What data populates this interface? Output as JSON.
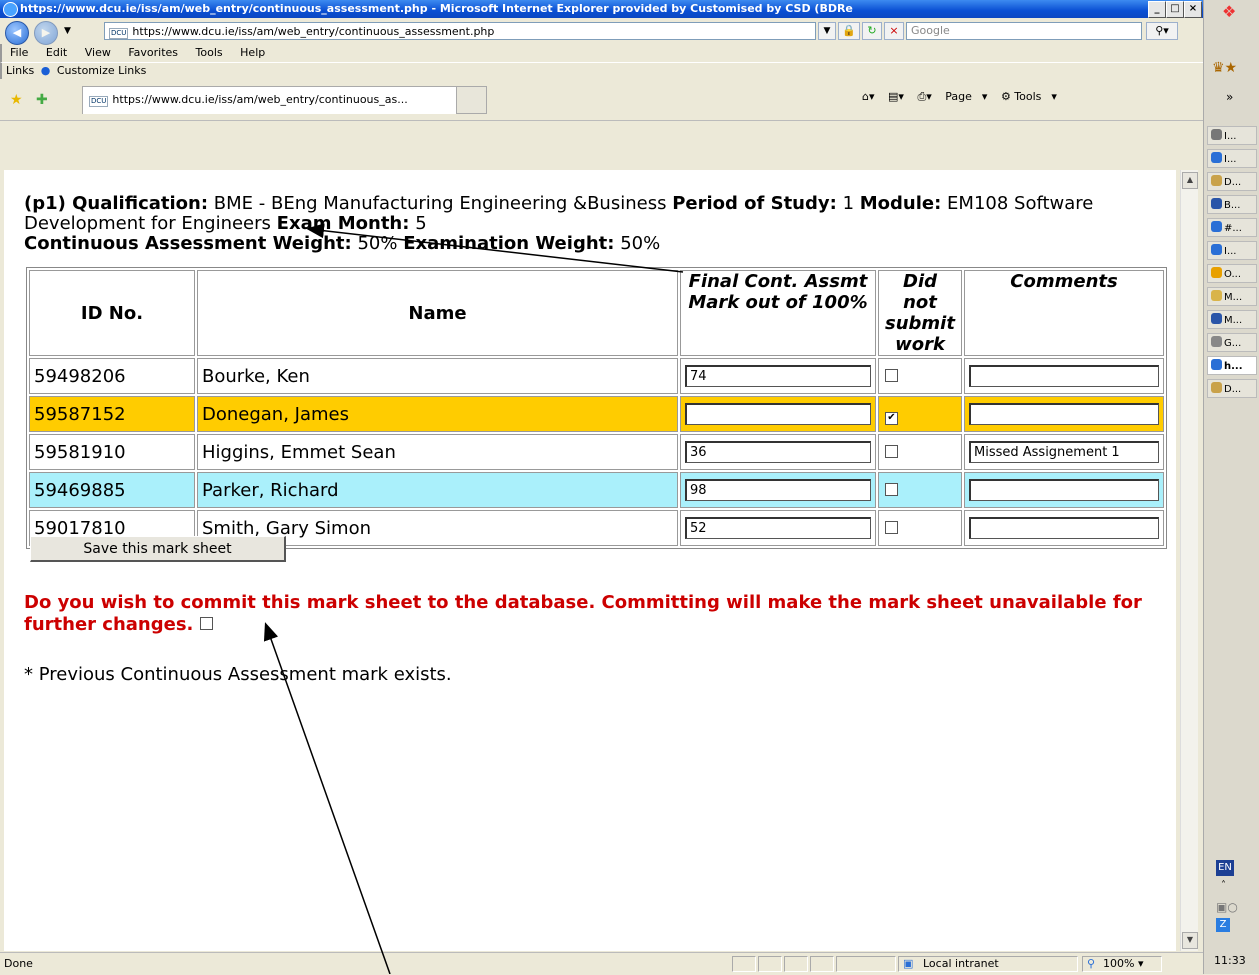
{
  "window": {
    "title": "https://www.dcu.ie/iss/am/web_entry/continuous_assessment.php - Microsoft Internet Explorer provided by Customised by CSD (BDRe"
  },
  "address": {
    "url": "https://www.dcu.ie/iss/am/web_entry/continuous_assessment.php",
    "search_placeholder": "Google",
    "favicon_text": "DCU"
  },
  "menu": [
    "File",
    "Edit",
    "View",
    "Favorites",
    "Tools",
    "Help"
  ],
  "links_bar": {
    "links_label": "Links",
    "customize": "Customize Links"
  },
  "tab": {
    "label": "https://www.dcu.ie/iss/am/web_entry/continuous_as..."
  },
  "command_bar": {
    "page": "Page",
    "tools": "Tools"
  },
  "header": {
    "prefix": "(p1) Qualification:",
    "qualification": "BME - BEng Manufacturing Engineering &Business",
    "period_label": "Period of Study:",
    "period": "1",
    "module_label": "Module:",
    "module": "EM108 Software Development for Engineers",
    "exam_month_label": "Exam Month:",
    "exam_month": "5",
    "ca_weight_label": "Continuous Assessment Weight:",
    "ca_weight": "50%",
    "exam_weight_label": "Examination Weight:",
    "exam_weight": "50%"
  },
  "table": {
    "columns": [
      "ID No.",
      "Name",
      "Final Cont. Assmt Mark out of 100%",
      "Did not submit work",
      "Comments"
    ],
    "rows": [
      {
        "id": "59498206",
        "name": "Bourke, Ken",
        "mark": "74",
        "did_not_submit": false,
        "comment": "",
        "highlight": "none"
      },
      {
        "id": "59587152",
        "name": "Donegan, James",
        "mark": "",
        "did_not_submit": true,
        "comment": "",
        "highlight": "yellow"
      },
      {
        "id": "59581910",
        "name": "Higgins, Emmet Sean",
        "mark": "36",
        "did_not_submit": false,
        "comment": "Missed Assignement 1",
        "highlight": "none"
      },
      {
        "id": "59469885",
        "name": "Parker, Richard",
        "mark": "98",
        "did_not_submit": false,
        "comment": "",
        "highlight": "cyan"
      },
      {
        "id": "59017810",
        "name": "Smith, Gary Simon",
        "mark": "52",
        "did_not_submit": false,
        "comment": "",
        "highlight": "none"
      }
    ]
  },
  "save_button": "Save this mark sheet",
  "commit_text": "Do you wish to commit this mark sheet to the database. Committing will make the mark sheet unavailable for further changes.",
  "previous_note": "* Previous Continuous Assessment mark exists.",
  "status": {
    "left": "Done",
    "zone": "Local intranet",
    "zoom": "100%"
  },
  "sidebar": {
    "items": [
      "I...",
      "I...",
      "D...",
      "B...",
      "#...",
      "I...",
      "O...",
      "M...",
      "M...",
      "G...",
      "h...",
      "D..."
    ],
    "lang": "EN",
    "time": "11:33"
  },
  "colors": {
    "highlight_yellow": "#ffcc00",
    "highlight_cyan": "#aaf0fb",
    "commit_red": "#cc0000",
    "titlebar_blue": "#0a4fd3"
  }
}
